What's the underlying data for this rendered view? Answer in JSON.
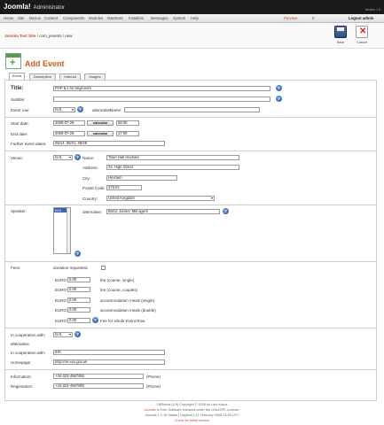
{
  "header": {
    "logo": "Joomla!",
    "logo_sub": "Administrator",
    "version": "Version 1.0"
  },
  "menu": {
    "items": [
      "Home",
      "Site",
      "Menus",
      "Content",
      "Components",
      "Modules",
      "Mambots",
      "Installers",
      "Messages",
      "System",
      "Help"
    ],
    "preview": "Preview",
    "counter": "0",
    "logout": "Logout admin"
  },
  "breadcrumb": {
    "site": "Joomla Test Site",
    "path": " / com_jevents / new"
  },
  "toolbar": {
    "save_label": "Save",
    "cancel_label": "Cancel"
  },
  "page": {
    "title": "Add Event"
  },
  "tabs": [
    "Event",
    "Description",
    "Internal",
    "Images"
  ],
  "form": {
    "title_label": "Title:",
    "title_value": "PHP 5.x for beginners",
    "subtitle_label": "Subtitle:",
    "subtitle_value": "",
    "eventrow_label": "Event row:",
    "eventrow_value": "N.N.",
    "alternative_label": "alternative",
    "name_label": "Name:",
    "name_value": "",
    "startdate_label": "Start date:",
    "startdate_value": "2008-07-29",
    "starttime_value": "08:00",
    "enddate_label": "End date:",
    "enddate_value": "2008-07-29",
    "endtime_value": "17:00",
    "calendar_label": "calendar",
    "further_label": "Further event dates:",
    "further_value": "08/14, 08/21, 08/28",
    "venue_label": "Venue:",
    "venue_select": "N.N.",
    "venue_name_label": "Name:",
    "venue_name": "Town Hall Hexham",
    "address_label": "Address:",
    "address": "34, High Street",
    "city_label": "City:",
    "city": "Hexham",
    "postcode_label": "Postal Code:",
    "postcode": "27SX3",
    "country_label": "Country:",
    "country": "United Kingdom",
    "speaker_label": "Speaker:",
    "speaker_option": "N.N.",
    "speaker_alternative_label": "alternative:",
    "speaker_alternative": "Bond, James; Mill agent",
    "fees_label": "Fees:",
    "donation_label": "donation requested",
    "fees": [
      {
        "currency": "EURO",
        "value": "0.00",
        "desc": "fee (course, single)"
      },
      {
        "currency": "EURO",
        "value": "0.00",
        "desc": "fee (course, couples)"
      },
      {
        "currency": "EURO",
        "value": "0.00",
        "desc": "accommodation meals (single)"
      },
      {
        "currency": "EURO",
        "value": "0.00",
        "desc": "accommodation meals (double)"
      },
      {
        "currency": "EURO",
        "value": "0.00",
        "desc": "Fee for whole Event Row"
      }
    ],
    "coop_label": "In cooperation with:",
    "coop_select": "N.N.",
    "coop_alt_label": "alternative",
    "coop_alt2_label": "In cooperation with:",
    "coop_alt2_value": "IHK",
    "homepage_label": "Homepage:",
    "homepage_value": "http://mr-xxx.gov.uk",
    "information_label": "Information:",
    "information_value": "+44-323-4567892",
    "information_suffix": "(Phone)",
    "registration_label": "Registration:",
    "registration_value": "+44-323-4567892",
    "registration_suffix": "(Phone)"
  },
  "footer": {
    "line1": "OffSeeds (0.9) Copyright © 2006 by Lars Kraus",
    "line2_link": "Joomla!",
    "line2": " is Free Software released under the GNU/GPL License.",
    "line3": "Joomla! 1.0.15 Stable [ Daytime ] 22 February 2008 23:00 UTC",
    "line4": "Check for latest version"
  }
}
